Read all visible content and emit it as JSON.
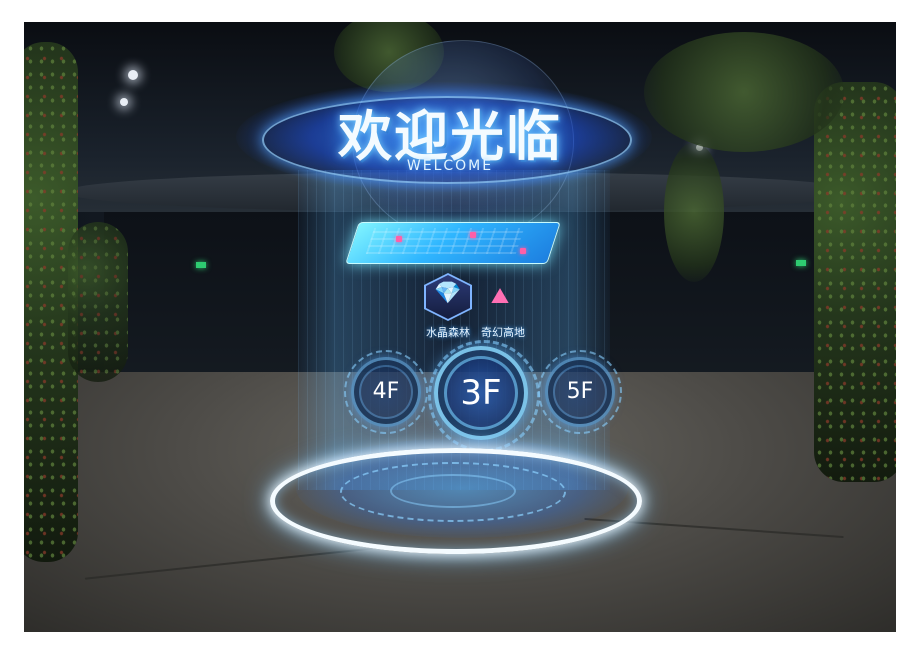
{
  "welcome": {
    "title": "欢迎光临",
    "subtitle": "WELCOME"
  },
  "zones": [
    {
      "label": "水晶森林",
      "icon": "crystal-icon",
      "glyph": "💎",
      "color": "#b06cff"
    },
    {
      "label": "奇幻高地",
      "icon": "mountain-icon",
      "glyph": "⛰",
      "color": "#ff6fb3"
    }
  ],
  "floors": {
    "left": "4F",
    "current": "3F",
    "right": "5F"
  },
  "colors": {
    "accent": "#3c9bff",
    "glow": "#7fd2ff",
    "ring": "#f4fbff"
  }
}
